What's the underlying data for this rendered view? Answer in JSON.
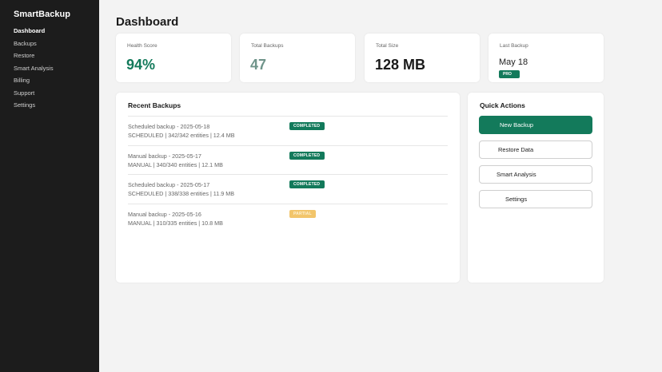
{
  "sidebar": {
    "brand": "SmartBackup",
    "items": [
      {
        "label": "Dashboard"
      },
      {
        "label": "Backups"
      },
      {
        "label": "Restore"
      },
      {
        "label": "Smart Analysis"
      },
      {
        "label": "Billing"
      },
      {
        "label": "Support"
      },
      {
        "label": "Settings"
      }
    ]
  },
  "main": {
    "title": "Dashboard",
    "stats": {
      "health": {
        "label": "Health Score",
        "value": "94%",
        "color": "#137a5b"
      },
      "total_backups": {
        "label": "Total Backups",
        "value": "47",
        "color": "#6f948a"
      },
      "total_size": {
        "label": "Total Size",
        "value": "128 MB",
        "color": "#1a1a1a"
      },
      "last_backup": {
        "label": "Last Backup",
        "value": "May 18",
        "badge": "PRO"
      }
    },
    "recent": {
      "title": "Recent Backups",
      "rows": [
        {
          "name": "Scheduled backup - 2025-05-18",
          "meta": "SCHEDULED | 342/342 entities | 12.4 MB",
          "status": "COMPLETED"
        },
        {
          "name": "Manual backup - 2025-05-17",
          "meta": "MANUAL | 340/340 entities | 12.1 MB",
          "status": "COMPLETED"
        },
        {
          "name": "Scheduled backup - 2025-05-17",
          "meta": "SCHEDULED | 338/338 entities | 11.9 MB",
          "status": "COMPLETED"
        },
        {
          "name": "Manual backup - 2025-05-16",
          "meta": "MANUAL | 310/335 entities | 10.8 MB",
          "status": "PARTIAL"
        }
      ]
    },
    "quick_actions": {
      "title": "Quick Actions",
      "new_backup": "New Backup",
      "restore_data": "Restore Data",
      "smart_analysis": "Smart Analysis",
      "settings": "Settings"
    }
  },
  "colors": {
    "accent": "#137a5b",
    "sidebar_bg": "#1c1c1c",
    "partial": "#f2c56b"
  }
}
